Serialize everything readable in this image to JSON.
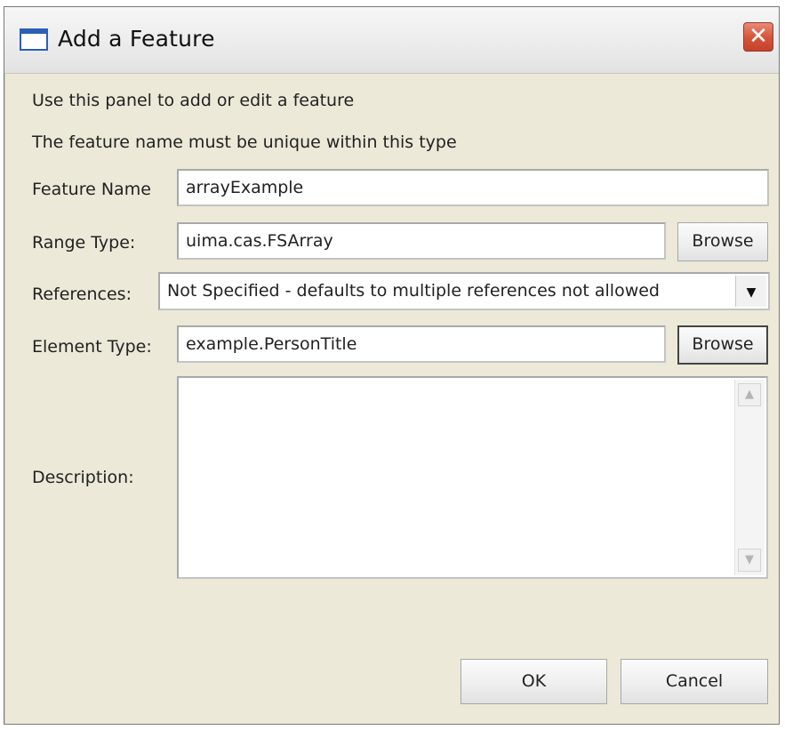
{
  "window": {
    "title": "Add a Feature",
    "close_glyph": "✕"
  },
  "intro": {
    "line1": "Use this panel to add or edit a feature",
    "line2": "The feature name must be unique within this type"
  },
  "form": {
    "feature_name": {
      "label": "Feature Name",
      "value": "arrayExample"
    },
    "range_type": {
      "label": "Range Type:",
      "value": "uima.cas.FSArray",
      "browse_label": "Browse"
    },
    "references": {
      "label": "References:",
      "selected": "Not Specified - defaults to multiple references not allowed",
      "arrow": "▼"
    },
    "element_type": {
      "label": "Element Type:",
      "value": "example.PersonTitle",
      "browse_label": "Browse"
    },
    "description": {
      "label": "Description:",
      "value": ""
    }
  },
  "buttons": {
    "ok": "OK",
    "cancel": "Cancel"
  },
  "icons": {
    "window_icon": "window-icon",
    "close": "close-icon",
    "dropdown": "chevron-down-icon",
    "scroll_up": "scroll-up-icon",
    "scroll_down": "scroll-down-icon"
  },
  "colors": {
    "dialog_bg": "#ece9d8",
    "close_red": "#d6573d",
    "title_icon_blue": "#2b5fb8"
  }
}
